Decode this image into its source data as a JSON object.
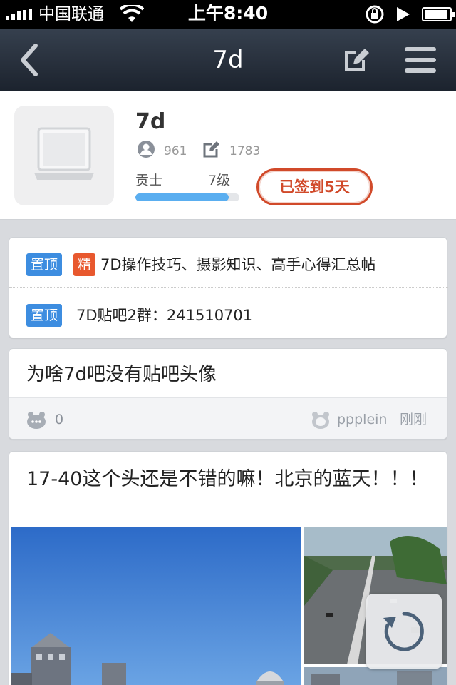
{
  "status_bar": {
    "carrier": "中国联通",
    "time": "上午8:40",
    "battery_level": 0.95
  },
  "navbar": {
    "title": "7d",
    "icons": [
      "back-arrow-icon",
      "edit-icon",
      "menu-icon"
    ]
  },
  "forum": {
    "name": "7d",
    "members": "961",
    "posts": "1783",
    "level_title": "贡士",
    "level": "7级",
    "level_progress": 0.9,
    "sign_status": "已签到5天"
  },
  "sticky_posts": [
    {
      "tags": [
        "置顶",
        "精"
      ],
      "title": "7D操作技巧、摄影知识、高手心得汇总帖"
    },
    {
      "tags": [
        "置顶"
      ],
      "title": "7D贴吧2群：241510701"
    }
  ],
  "threads": [
    {
      "title": "为啥7d吧没有贴吧头像",
      "replies": "0",
      "author": "ppplein",
      "time": "刚刚"
    },
    {
      "title": "17-40这个头还是不错的嘛！北京的蓝天！！！"
    }
  ],
  "colors": {
    "navbar": "#2a323e",
    "tag_top": "#3d8de0",
    "tag_essence": "#e8582e",
    "sign_stamp": "#d14a2a",
    "level_bar": "#5aaef0"
  }
}
